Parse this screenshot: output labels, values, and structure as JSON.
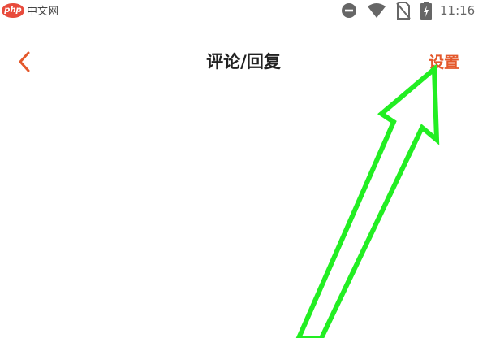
{
  "watermark": {
    "badge": "php",
    "site": "中文网"
  },
  "status_bar": {
    "time": "11:16",
    "icons": [
      "do-not-disturb-icon",
      "wifi-icon",
      "no-sim-icon",
      "battery-charging-icon"
    ]
  },
  "nav": {
    "back_icon": "chevron-left-icon",
    "title": "评论/回复",
    "settings_label": "设置"
  },
  "colors": {
    "accent": "#e4582b",
    "title": "#222222",
    "status_icons": "#666666",
    "annotation_arrow": "#22ee22"
  }
}
